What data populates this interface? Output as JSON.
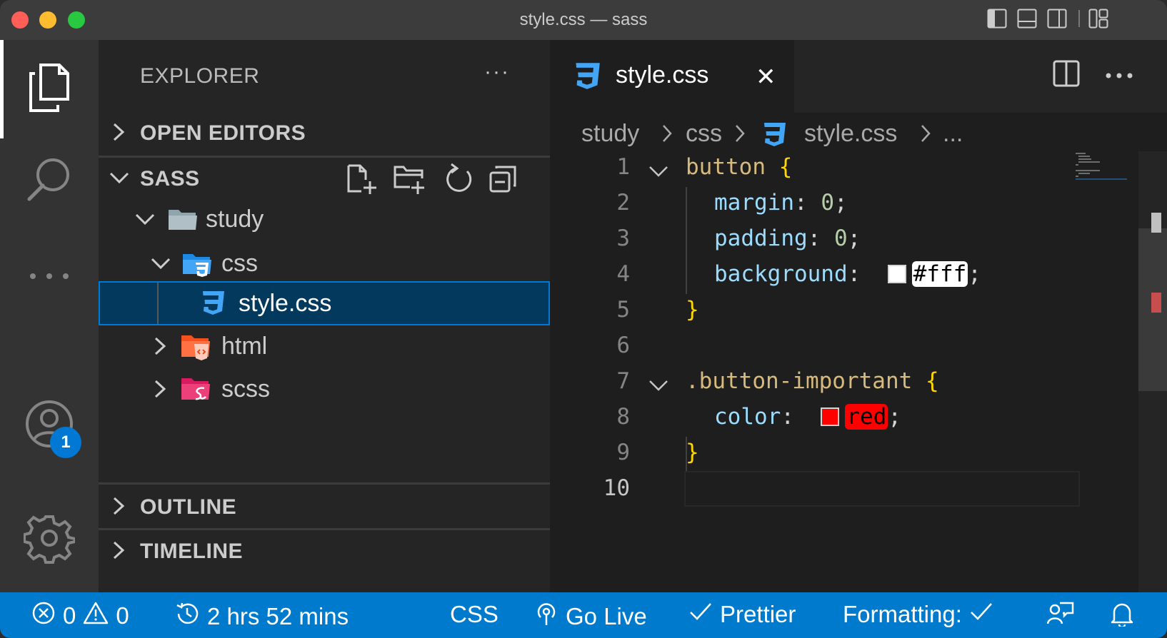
{
  "window": {
    "title": "style.css — sass"
  },
  "activity_bar": {
    "items": [
      {
        "icon": "explorer-icon",
        "active": true
      },
      {
        "icon": "search-icon"
      },
      {
        "icon": "more-icon"
      },
      {
        "icon": "accounts-icon",
        "badge": "1"
      },
      {
        "icon": "gear-icon"
      }
    ]
  },
  "sidebar": {
    "title": "EXPLORER",
    "more": "···",
    "sections": {
      "open_editors": "OPEN EDITORS",
      "sass": "SASS",
      "outline": "OUTLINE",
      "timeline": "TIMELINE"
    },
    "tree": [
      {
        "label": "study",
        "type": "folder",
        "expanded": true,
        "icon": "folder-icon"
      },
      {
        "label": "css",
        "type": "folder",
        "expanded": true,
        "icon": "css-folder-icon"
      },
      {
        "label": "style.css",
        "type": "file",
        "selected": true,
        "icon": "css3-icon"
      },
      {
        "label": "html",
        "type": "folder",
        "expanded": false,
        "icon": "html-folder-icon"
      },
      {
        "label": "scss",
        "type": "folder",
        "expanded": false,
        "icon": "sass-folder-icon"
      }
    ]
  },
  "editor": {
    "tab": {
      "label": "style.css",
      "close": "✕"
    },
    "breadcrumb": [
      "study",
      "css",
      "style.css",
      "..."
    ],
    "code": {
      "l1": {
        "n": "1",
        "sel": "button",
        "brace": "{"
      },
      "l2": {
        "n": "2",
        "prop": "margin",
        "colon": ": ",
        "val": "0",
        "semi": ";"
      },
      "l3": {
        "n": "3",
        "prop": "padding",
        "colon": ": ",
        "val": "0",
        "semi": ";"
      },
      "l4": {
        "n": "4",
        "prop": "background",
        "colon": ": ",
        "val": "#fff",
        "semi": ";",
        "swatch": "#ffffff"
      },
      "l5": {
        "n": "5",
        "brace": "}"
      },
      "l6": {
        "n": "6"
      },
      "l7": {
        "n": "7",
        "sel": ".button-important",
        "brace": "{"
      },
      "l8": {
        "n": "8",
        "prop": "color",
        "colon": ": ",
        "val": "red",
        "semi": ";",
        "swatch": "#ff0000"
      },
      "l9": {
        "n": "9",
        "brace": "}"
      },
      "l10": {
        "n": "10"
      }
    }
  },
  "status_bar": {
    "errors": "0",
    "warnings": "0",
    "time": "2 hrs 52 mins",
    "language": "CSS",
    "go_live": "Go Live",
    "prettier": "Prettier",
    "formatting": "Formatting:"
  },
  "colors": {
    "accent": "#007acc",
    "selection": "#04395e",
    "css_icon": "#42a5f5"
  }
}
